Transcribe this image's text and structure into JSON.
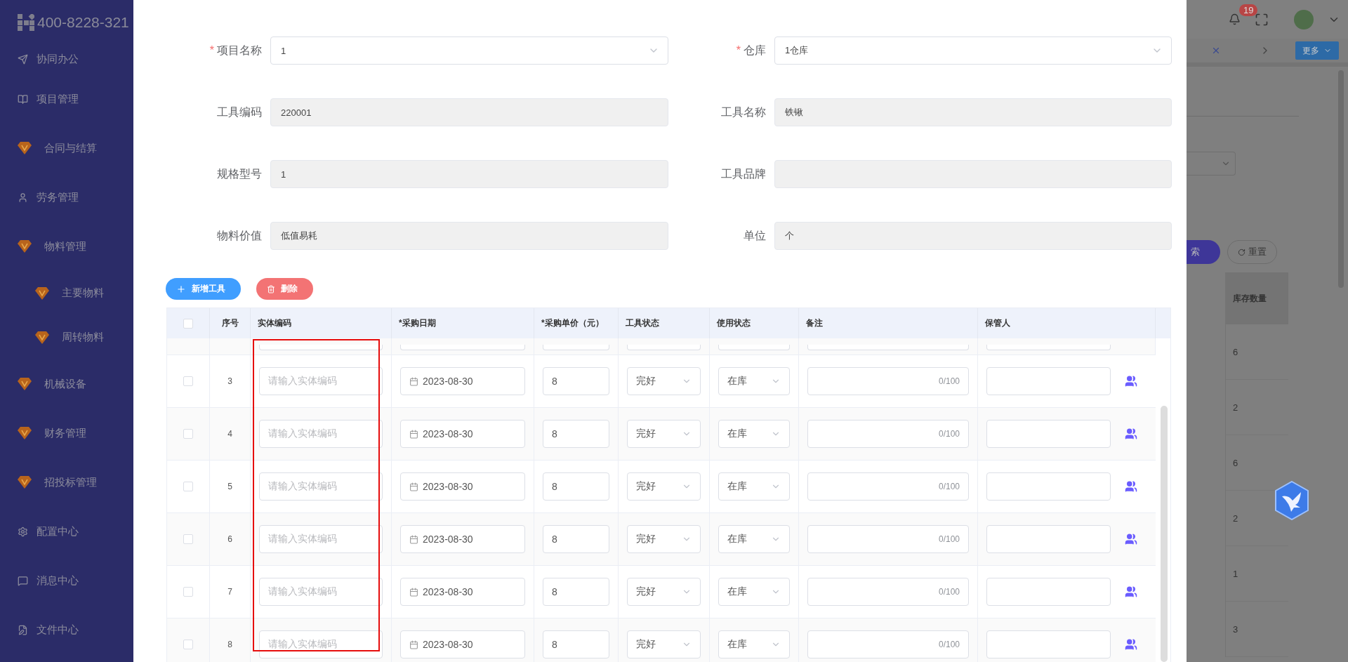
{
  "sidebar": {
    "logo_text": "400-8228-321",
    "items": [
      {
        "label": "协同办公",
        "kind": "send"
      },
      {
        "label": "项目管理",
        "kind": "book"
      },
      {
        "label": "合同与结算",
        "kind": "gem"
      },
      {
        "label": "劳务管理",
        "kind": "user"
      },
      {
        "label": "物料管理",
        "kind": "gem",
        "children": [
          {
            "label": "主要物料",
            "kind": "gem"
          },
          {
            "label": "周转物料",
            "kind": "gem"
          }
        ]
      },
      {
        "label": "机械设备",
        "kind": "gem"
      },
      {
        "label": "财务管理",
        "kind": "gem"
      },
      {
        "label": "招投标管理",
        "kind": "gem"
      },
      {
        "label": "配置中心",
        "kind": "gear"
      },
      {
        "label": "消息中心",
        "kind": "chat"
      },
      {
        "label": "文件中心",
        "kind": "doc"
      }
    ]
  },
  "background_page": {
    "notification_count": "19",
    "more_button": "更多",
    "search_button": "索",
    "reset_button": "重置",
    "column": "库存数量",
    "values": [
      "6",
      "2",
      "6",
      "2",
      "1",
      "3"
    ]
  },
  "form": {
    "fields": [
      {
        "label": "项目名称",
        "value": "1",
        "required_mark": "*",
        "kind": "select"
      },
      {
        "label": "仓库",
        "value": "1仓库",
        "required_mark": "*",
        "kind": "select"
      },
      {
        "label": "工具编码",
        "value": "220001",
        "kind": "readonly"
      },
      {
        "label": "工具名称",
        "value": "铁锹",
        "kind": "readonly"
      },
      {
        "label": "规格型号",
        "value": "1",
        "kind": "readonly"
      },
      {
        "label": "工具品牌",
        "kind": "readonly"
      },
      {
        "label": "物料价值",
        "value": "低值易耗",
        "kind": "readonly"
      },
      {
        "label": "单位",
        "value": "个",
        "kind": "readonly"
      }
    ]
  },
  "toolbar": [
    {
      "label": "新增工具",
      "kind": "add"
    },
    {
      "label": "删除",
      "kind": "delete"
    }
  ],
  "table": {
    "header_checked": false,
    "columns": [
      "序号",
      "实体编码",
      "*采购日期",
      "*采购单价（元）",
      "工具状态",
      "使用状态",
      "备注",
      "保管人"
    ],
    "rows": [
      {
        "checked": false,
        "index": "3",
        "code_placeholder": "请输入实体编码",
        "date": "2023-08-30",
        "price": "8",
        "tool_status": "完好",
        "use_status": "在库",
        "note_counter": "0/100"
      },
      {
        "checked": false,
        "index": "4",
        "code_placeholder": "请输入实体编码",
        "date": "2023-08-30",
        "price": "8",
        "tool_status": "完好",
        "use_status": "在库",
        "note_counter": "0/100"
      },
      {
        "checked": false,
        "index": "5",
        "code_placeholder": "请输入实体编码",
        "date": "2023-08-30",
        "price": "8",
        "tool_status": "完好",
        "use_status": "在库",
        "note_counter": "0/100"
      },
      {
        "checked": false,
        "index": "6",
        "code_placeholder": "请输入实体编码",
        "date": "2023-08-30",
        "price": "8",
        "tool_status": "完好",
        "use_status": "在库",
        "note_counter": "0/100"
      },
      {
        "checked": false,
        "index": "7",
        "code_placeholder": "请输入实体编码",
        "date": "2023-08-30",
        "price": "8",
        "tool_status": "完好",
        "use_status": "在库",
        "note_counter": "0/100"
      },
      {
        "checked": false,
        "index": "8",
        "code_placeholder": "请输入实体编码",
        "date": "2023-08-30",
        "price": "8",
        "tool_status": "完好",
        "use_status": "在库",
        "note_counter": "0/100"
      }
    ]
  }
}
